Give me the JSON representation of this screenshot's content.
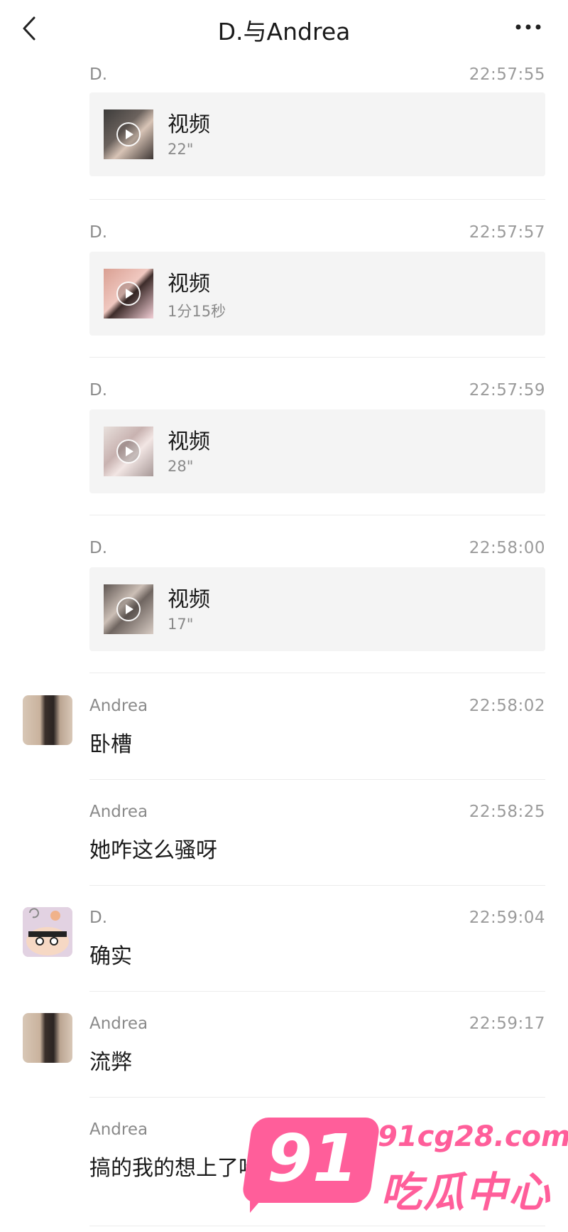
{
  "header": {
    "title": "D.与Andrea",
    "back_icon": "chevron-left-icon",
    "more_icon": "more-dots-icon"
  },
  "messages": [
    {
      "sender": "D.",
      "time": "22:57:55",
      "type": "video",
      "video_label": "视频",
      "duration": "22\""
    },
    {
      "sender": "D.",
      "time": "22:57:57",
      "type": "video",
      "video_label": "视频",
      "duration": "1分15秒"
    },
    {
      "sender": "D.",
      "time": "22:57:59",
      "type": "video",
      "video_label": "视频",
      "duration": "28\""
    },
    {
      "sender": "D.",
      "time": "22:58:00",
      "type": "video",
      "video_label": "视频",
      "duration": "17\""
    },
    {
      "sender": "Andrea",
      "time": "22:58:02",
      "type": "text",
      "text": "卧槽"
    },
    {
      "sender": "Andrea",
      "time": "22:58:25",
      "type": "text",
      "text": "她咋这么骚呀"
    },
    {
      "sender": "D.",
      "time": "22:59:04",
      "type": "text",
      "text": "确实"
    },
    {
      "sender": "Andrea",
      "time": "22:59:17",
      "type": "text",
      "text": "流弊"
    },
    {
      "sender": "Andrea",
      "time": "",
      "type": "text",
      "text": "搞的我的想上了哈哈哈"
    }
  ],
  "watermark": {
    "badge": "91",
    "domain": "91cg28.com",
    "name": "吃瓜中心",
    "color": "#ff5e9a"
  }
}
